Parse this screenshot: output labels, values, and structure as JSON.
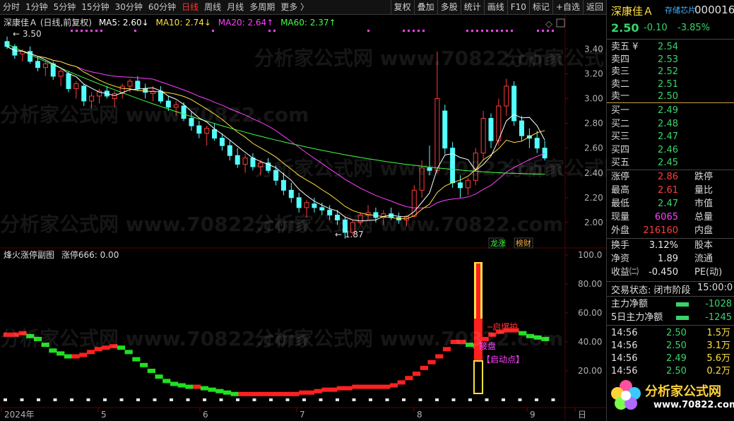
{
  "toolbar": {
    "left": [
      "分时",
      "1分钟",
      "5分钟",
      "15分钟",
      "30分钟",
      "60分钟",
      "日线",
      "周线",
      "月线",
      "多周期",
      "更多 〉"
    ],
    "active": "日线",
    "right": [
      "复权",
      "叠加",
      "多股",
      "统计",
      "画线",
      "F10",
      "标记",
      "+自选",
      "返回"
    ]
  },
  "legend_main": {
    "title": "深康佳Ａ (日线,前复权)",
    "ma5": "MA5: 2.60↓",
    "ma10": "MA10: 2.74↓",
    "ma20": "MA20: 2.64↑",
    "ma60": "MA60: 2.37↑",
    "colors": {
      "ma5": "#ffffff",
      "ma10": "#ffe040",
      "ma20": "#ff40ff",
      "ma60": "#40ff40"
    }
  },
  "legend_sub": {
    "title": "烽火涨停副图",
    "value": "涨停666: 0.00"
  },
  "price_axis": [
    "3.40",
    "3.20",
    "3.00",
    "2.80",
    "2.60",
    "2.40",
    "2.20",
    "2.00"
  ],
  "sub_axis": [
    "100.0",
    "80.00",
    "60.00",
    "40.00",
    "20.00"
  ],
  "time_axis": [
    "2024年",
    "5",
    "6",
    "7",
    "8",
    "9",
    "日"
  ],
  "annotations": {
    "high": "3.50",
    "low": "1.87",
    "tag1": "龙",
    "tag1b": "涨",
    "tag2": "榜",
    "tag2b": "财",
    "qibao": "启爆拍",
    "jiepan": "接盘",
    "qidong": "【启动点】"
  },
  "watermark": "分析家公式网 www.70822.com",
  "side": {
    "name": "深康佳Ａ",
    "sub": "存储芯片",
    "code": "000016",
    "price": "2.50",
    "change": "-0.10",
    "pct": "-3.85%",
    "asks": [
      {
        "l": "卖五",
        "v": "2.54",
        "n": "¥"
      },
      {
        "l": "卖四",
        "v": "2.53",
        "n": ""
      },
      {
        "l": "卖三",
        "v": "2.52",
        "n": ""
      },
      {
        "l": "卖二",
        "v": "2.51",
        "n": ""
      },
      {
        "l": "卖一",
        "v": "2.50",
        "n": ""
      }
    ],
    "bids": [
      {
        "l": "买一",
        "v": "2.49"
      },
      {
        "l": "买二",
        "v": "2.48"
      },
      {
        "l": "买三",
        "v": "2.47"
      },
      {
        "l": "买四",
        "v": "2.46"
      },
      {
        "l": "买五",
        "v": "2.45"
      }
    ],
    "stats": [
      {
        "l": "涨停",
        "v": "2.86",
        "c": "rd",
        "r": "跌停"
      },
      {
        "l": "最高",
        "v": "2.61",
        "c": "rd",
        "r": "量比"
      },
      {
        "l": "最低",
        "v": "2.47",
        "c": "g",
        "r": "市值"
      },
      {
        "l": "现量",
        "v": "6065",
        "c": "mg",
        "r": "总量"
      },
      {
        "l": "外盘",
        "v": "216160",
        "c": "rd",
        "r": "内盘"
      }
    ],
    "stats2": [
      {
        "l": "换手",
        "v": "3.12%",
        "c": "wh",
        "r": "股本"
      },
      {
        "l": "净资",
        "v": "1.89",
        "c": "wh",
        "r": "流通"
      },
      {
        "l": "收益㈡",
        "v": "-0.450",
        "c": "wh",
        "r": "PE(动)"
      }
    ],
    "status_label": "交易状态: 闭市阶段",
    "status_time": "15:00:0",
    "flows": [
      {
        "l": "主力净额",
        "v": "-1028"
      },
      {
        "l": "5日主力净额",
        "v": "-1245"
      }
    ],
    "ticks": [
      {
        "t": "14:56",
        "p": "2.50",
        "v": "1.5万",
        "vc": "yl"
      },
      {
        "t": "14:56",
        "p": "2.50",
        "v": "3.1万",
        "vc": "yl"
      },
      {
        "t": "14:56",
        "p": "2.49",
        "v": "5.6万",
        "vc": "yl"
      },
      {
        "t": "14:56",
        "p": "2.50",
        "v": "0.2万",
        "vc": "yl"
      }
    ],
    "logo_cn": "分析家公式网",
    "logo_url": "www.70822.com"
  },
  "chart_data": {
    "type": "candlestick",
    "ylim": [
      1.8,
      3.55
    ],
    "candles": [
      [
        3.46,
        3.5,
        3.4,
        3.42
      ],
      [
        3.42,
        3.44,
        3.32,
        3.35
      ],
      [
        3.36,
        3.4,
        3.3,
        3.38
      ],
      [
        3.38,
        3.42,
        3.28,
        3.3
      ],
      [
        3.3,
        3.34,
        3.22,
        3.25
      ],
      [
        3.25,
        3.3,
        3.18,
        3.28
      ],
      [
        3.28,
        3.3,
        3.15,
        3.18
      ],
      [
        3.18,
        3.24,
        3.1,
        3.22
      ],
      [
        3.2,
        3.22,
        3.05,
        3.08
      ],
      [
        3.08,
        3.14,
        3.0,
        3.12
      ],
      [
        3.1,
        3.12,
        2.94,
        2.98
      ],
      [
        2.98,
        3.05,
        2.92,
        3.02
      ],
      [
        3.02,
        3.08,
        2.96,
        3.06
      ],
      [
        3.06,
        3.1,
        3.0,
        3.02
      ],
      [
        3.0,
        3.06,
        2.93,
        3.04
      ],
      [
        3.04,
        3.12,
        3.0,
        3.1
      ],
      [
        3.1,
        3.16,
        3.05,
        3.14
      ],
      [
        3.14,
        3.18,
        3.06,
        3.08
      ],
      [
        3.08,
        3.12,
        3.0,
        3.05
      ],
      [
        3.04,
        3.1,
        2.98,
        3.06
      ],
      [
        3.06,
        3.1,
        2.96,
        2.98
      ],
      [
        2.98,
        3.02,
        2.9,
        2.93
      ],
      [
        2.93,
        2.98,
        2.86,
        2.95
      ],
      [
        2.94,
        2.97,
        2.82,
        2.84
      ],
      [
        2.84,
        2.9,
        2.74,
        2.78
      ],
      [
        2.78,
        2.82,
        2.68,
        2.72
      ],
      [
        2.72,
        2.78,
        2.62,
        2.76
      ],
      [
        2.75,
        2.8,
        2.66,
        2.68
      ],
      [
        2.68,
        2.72,
        2.58,
        2.62
      ],
      [
        2.62,
        2.66,
        2.5,
        2.54
      ],
      [
        2.54,
        2.6,
        2.44,
        2.47
      ],
      [
        2.47,
        2.55,
        2.4,
        2.52
      ],
      [
        2.52,
        2.56,
        2.42,
        2.45
      ],
      [
        2.45,
        2.5,
        2.38,
        2.48
      ],
      [
        2.48,
        2.52,
        2.4,
        2.42
      ],
      [
        2.42,
        2.46,
        2.3,
        2.34
      ],
      [
        2.34,
        2.4,
        2.22,
        2.26
      ],
      [
        2.26,
        2.32,
        2.16,
        2.2
      ],
      [
        2.2,
        2.24,
        2.08,
        2.12
      ],
      [
        2.12,
        2.18,
        2.04,
        2.16
      ],
      [
        2.15,
        2.2,
        2.08,
        2.12
      ],
      [
        2.12,
        2.16,
        2.06,
        2.1
      ],
      [
        2.1,
        2.14,
        2.02,
        2.06
      ],
      [
        2.06,
        2.1,
        1.98,
        2.02
      ],
      [
        2.02,
        2.04,
        1.87,
        1.92
      ],
      [
        1.92,
        2.02,
        1.9,
        2.0
      ],
      [
        2.0,
        2.08,
        1.98,
        2.06
      ],
      [
        2.06,
        2.14,
        2.02,
        2.08
      ],
      [
        2.08,
        2.12,
        2.0,
        2.04
      ],
      [
        2.04,
        2.1,
        1.98,
        2.07
      ],
      [
        2.07,
        2.12,
        2.02,
        2.04
      ],
      [
        2.04,
        2.08,
        1.99,
        2.02
      ],
      [
        2.02,
        2.06,
        1.97,
        2.05
      ],
      [
        2.05,
        2.3,
        2.04,
        2.26
      ],
      [
        2.26,
        2.5,
        2.2,
        2.44
      ],
      [
        2.44,
        2.62,
        2.38,
        2.42
      ],
      [
        2.42,
        3.38,
        2.4,
        3.0
      ],
      [
        2.9,
        2.95,
        2.55,
        2.6
      ],
      [
        2.6,
        2.65,
        2.28,
        2.32
      ],
      [
        2.32,
        2.38,
        2.2,
        2.28
      ],
      [
        2.28,
        2.36,
        2.22,
        2.34
      ],
      [
        2.34,
        2.6,
        2.3,
        2.56
      ],
      [
        2.56,
        2.9,
        2.5,
        2.84
      ],
      [
        2.84,
        2.88,
        2.6,
        2.66
      ],
      [
        2.66,
        3.0,
        2.62,
        2.94
      ],
      [
        2.94,
        3.16,
        2.86,
        3.1
      ],
      [
        3.1,
        3.14,
        2.78,
        2.82
      ],
      [
        2.82,
        2.86,
        2.66,
        2.7
      ],
      [
        2.7,
        2.76,
        2.6,
        2.68
      ],
      [
        2.68,
        2.74,
        2.56,
        2.6
      ],
      [
        2.6,
        2.66,
        2.5,
        2.52
      ]
    ],
    "ma5_last": 2.6,
    "ma10_last": 2.74,
    "ma20_last": 2.64,
    "ma60_last": 2.37,
    "sub_line": [
      45,
      45,
      46,
      44,
      42,
      38,
      34,
      32,
      30,
      30,
      31,
      33,
      35,
      36,
      37,
      36,
      33,
      28,
      24,
      20,
      16,
      13,
      11,
      10,
      9,
      9,
      8,
      7,
      6,
      5,
      4,
      4,
      4,
      4,
      4,
      4,
      4,
      4,
      4,
      5,
      5,
      6,
      7,
      7,
      8,
      8,
      9,
      9,
      9,
      9,
      9,
      10,
      12,
      15,
      18,
      22,
      26,
      30,
      35,
      40,
      40,
      38,
      37,
      42,
      45,
      47,
      48,
      48,
      46,
      44,
      43,
      42
    ]
  }
}
